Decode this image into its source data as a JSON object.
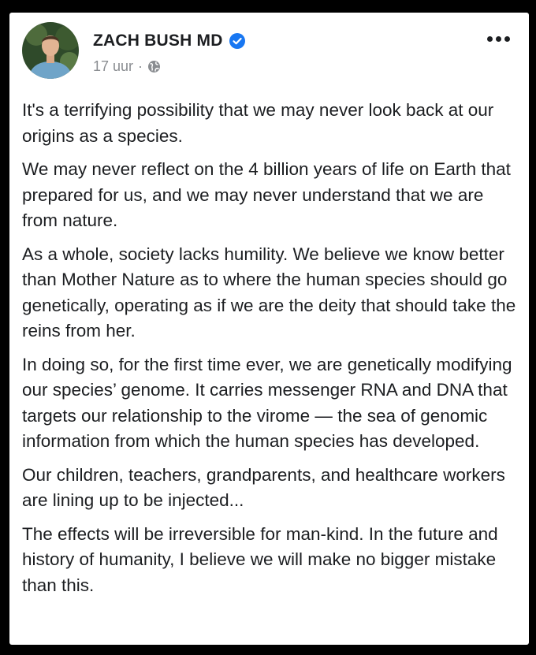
{
  "post": {
    "author": "ZACH BUSH MD",
    "timestamp": "17 uur",
    "separator": "·",
    "icons": {
      "verified": "verified-badge-icon",
      "audience": "globe-icon",
      "more": "more-options-icon"
    },
    "accent_color": "#1877f2",
    "paragraphs": [
      "It's a terrifying possibility that we may never look back at our origins as a species.",
      "We may never reflect on the 4 billion years of life on Earth that prepared for us, and we may never understand that we are from nature.",
      "As a whole, society lacks humility. We believe we know better than Mother Nature as to where the human species should go genetically, operating as if we are the deity that should take the reins from her.",
      "In doing so, for the first time ever, we are genetically modifying our species’ genome. It carries messenger RNA and DNA that targets our relationship to the virome — the sea of genomic information from which the human species has developed.",
      "Our children, teachers, grandparents, and healthcare workers are lining up to be injected...",
      "The effects will be irreversible for man-kind. In the future and history of humanity, I believe we will make no bigger mistake than this."
    ]
  }
}
